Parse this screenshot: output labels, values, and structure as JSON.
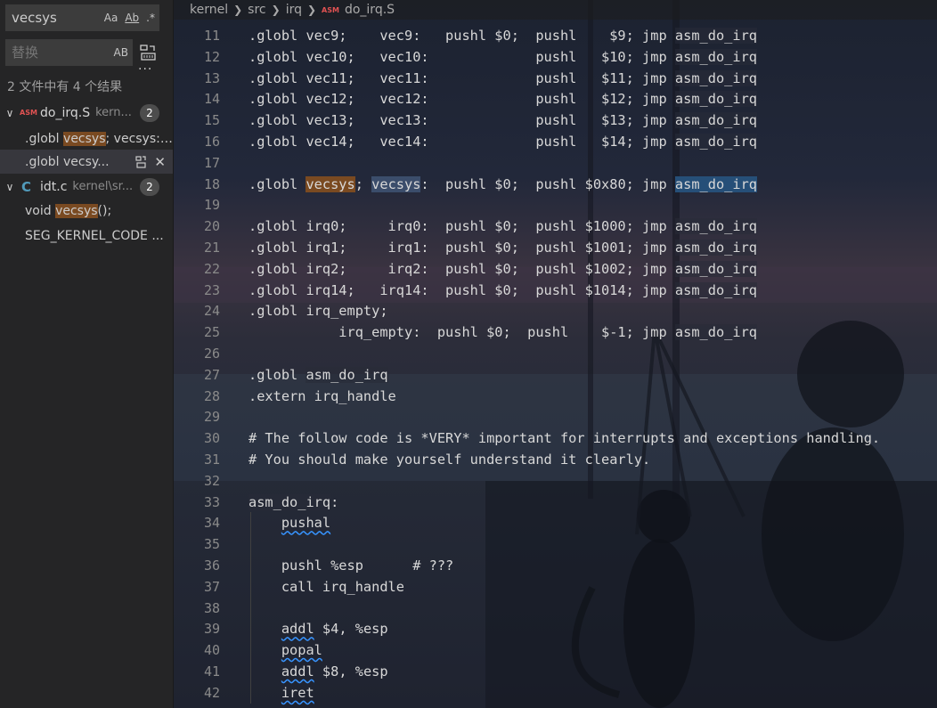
{
  "search": {
    "query": "vecsys",
    "match_case": "Aa",
    "whole_word": "Ab",
    "regex": ".*",
    "replace_placeholder": "替换",
    "preserve_case": "AB",
    "more": "···",
    "summary": "2 文件中有 4 个结果"
  },
  "results": {
    "files": [
      {
        "name": "do_irq.S",
        "path": "kern...",
        "icon": "ASM",
        "count": "2",
        "matches": [
          {
            "before": ".globl ",
            "match": "vecsys",
            "after": "; vecsys: ..."
          },
          {
            "before": ".globl vecsy...",
            "match": "",
            "after": ""
          }
        ]
      },
      {
        "name": "idt.c",
        "path": "kernel\\sr...",
        "icon": "C",
        "count": "2",
        "matches": [
          {
            "before": "void ",
            "match": "vecsys",
            "after": "();"
          },
          {
            "before": "SEG_KERNEL_CODE ...",
            "match": "",
            "after": ""
          }
        ]
      }
    ]
  },
  "breadcrumb": {
    "items": [
      "kernel",
      "src",
      "irq"
    ],
    "file_icon": "ASM",
    "file": "do_irq.S"
  },
  "editor": {
    "lines": [
      {
        "n": "11",
        "t": ".globl vec9;    vec9:   pushl $0;  pushl    $9; jmp asm_do_irq"
      },
      {
        "n": "12",
        "t": ".globl vec10;   vec10:             pushl   $10; jmp asm_do_irq"
      },
      {
        "n": "13",
        "t": ".globl vec11;   vec11:             pushl   $11; jmp asm_do_irq"
      },
      {
        "n": "14",
        "t": ".globl vec12;   vec12:             pushl   $12; jmp asm_do_irq"
      },
      {
        "n": "15",
        "t": ".globl vec13;   vec13:             pushl   $13; jmp asm_do_irq"
      },
      {
        "n": "16",
        "t": ".globl vec14;   vec14:             pushl   $14; jmp asm_do_irq"
      },
      {
        "n": "17",
        "t": ""
      },
      {
        "n": "18",
        "t": ".globl vecsys; vecsys:  pushl $0;  pushl $0x80; jmp asm_do_irq"
      },
      {
        "n": "19",
        "t": ""
      },
      {
        "n": "20",
        "t": ".globl irq0;     irq0:  pushl $0;  pushl $1000; jmp asm_do_irq"
      },
      {
        "n": "21",
        "t": ".globl irq1;     irq1:  pushl $0;  pushl $1001; jmp asm_do_irq"
      },
      {
        "n": "22",
        "t": ".globl irq2;     irq2:  pushl $0;  pushl $1002; jmp asm_do_irq"
      },
      {
        "n": "23",
        "t": ".globl irq14;   irq14:  pushl $0;  pushl $1014; jmp asm_do_irq"
      },
      {
        "n": "24",
        "t": ".globl irq_empty;"
      },
      {
        "n": "25",
        "t": "           irq_empty:  pushl $0;  pushl    $-1; jmp asm_do_irq"
      },
      {
        "n": "26",
        "t": ""
      },
      {
        "n": "27",
        "t": ".globl asm_do_irq"
      },
      {
        "n": "28",
        "t": ".extern irq_handle"
      },
      {
        "n": "29",
        "t": ""
      },
      {
        "n": "30",
        "t": "# The follow code is *VERY* important for interrupts and exceptions handling."
      },
      {
        "n": "31",
        "t": "# You should make yourself understand it clearly."
      },
      {
        "n": "32",
        "t": ""
      },
      {
        "n": "33",
        "t": "asm_do_irq:"
      },
      {
        "n": "34",
        "t": "    pushal"
      },
      {
        "n": "35",
        "t": ""
      },
      {
        "n": "36",
        "t": "    pushl %esp      # ???"
      },
      {
        "n": "37",
        "t": "    call irq_handle"
      },
      {
        "n": "38",
        "t": ""
      },
      {
        "n": "39",
        "t": "    addl $4, %esp"
      },
      {
        "n": "40",
        "t": "    popal"
      },
      {
        "n": "41",
        "t": "    addl $8, %esp"
      },
      {
        "n": "42",
        "t": "    iret"
      }
    ]
  },
  "colors": {
    "accent": "#264f78",
    "match_highlight": "#7a4a21",
    "asm_icon": "#e05252",
    "c_icon": "#519aba"
  }
}
